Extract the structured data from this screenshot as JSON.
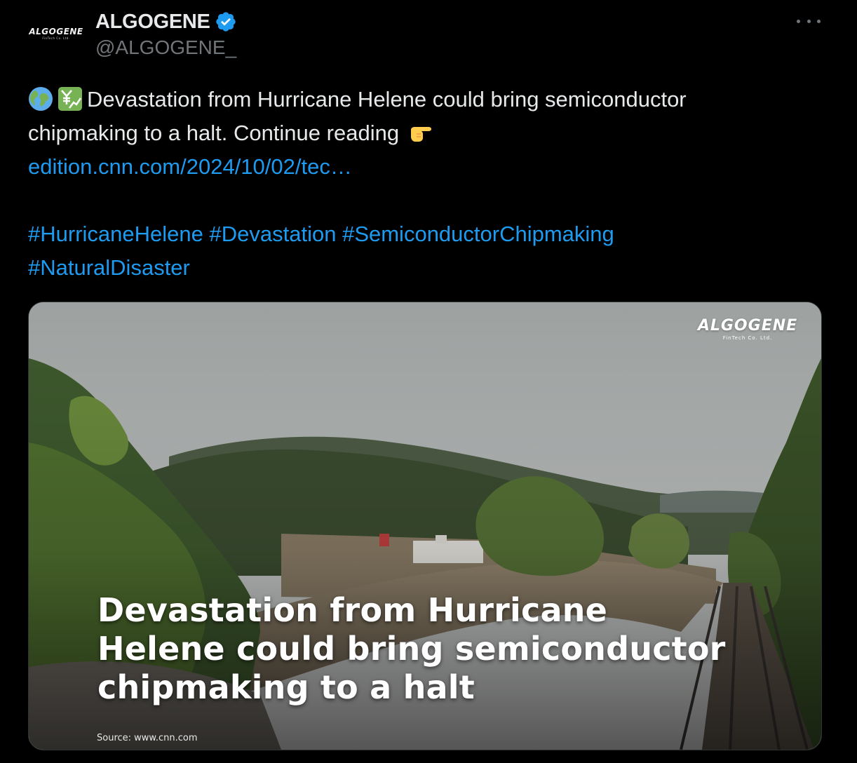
{
  "author": {
    "display_name": "ALGOGENE",
    "handle": "@ALGOGENE_",
    "avatar_logo_text": "ALGOGENE",
    "avatar_logo_subtext": "FinTech Co. Ltd."
  },
  "tweet": {
    "emoji_1": "globe-icon",
    "emoji_2": "yen-chart-icon",
    "text_line_1": "Devastation from Hurricane Helene could bring semiconductor",
    "text_line_2": "chipmaking to a halt. Continue reading",
    "emoji_3": "pointing-right-icon",
    "link": "edition.cnn.com/2024/10/02/tec…",
    "hashtags_line_1": [
      "#HurricaneHelene",
      "#Devastation",
      "#SemiconductorChipmaking"
    ],
    "hashtags_line_2": [
      "#NaturalDisaster"
    ]
  },
  "media": {
    "headline_line_1": "Devastation from Hurricane",
    "headline_line_2": "Helene could bring semiconductor",
    "headline_line_3": "chipmaking to a halt",
    "source": "Source: www.cnn.com",
    "watermark_text": "ALGOGENE",
    "watermark_subtext": "FinTech Co. Ltd."
  },
  "colors": {
    "background": "#000000",
    "text": "#e7e9ea",
    "secondary_text": "#71767b",
    "link": "#1d9bf0",
    "verified_badge": "#1d9bf0"
  }
}
